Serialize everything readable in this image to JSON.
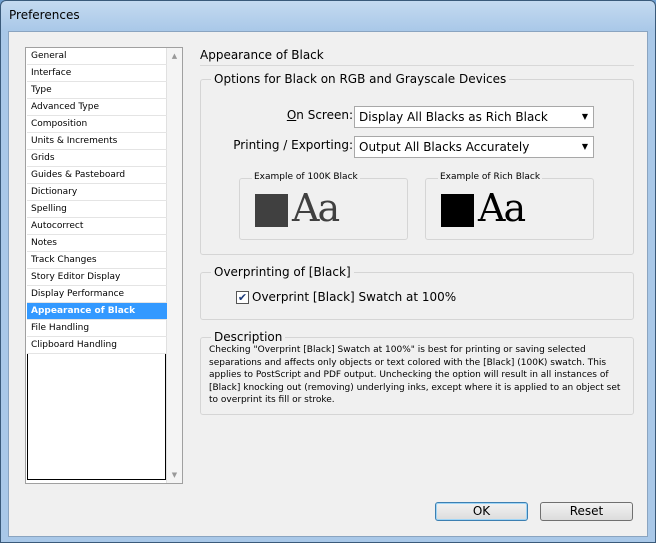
{
  "window": {
    "title": "Preferences"
  },
  "sidebar": {
    "items": [
      "General",
      "Interface",
      "Type",
      "Advanced Type",
      "Composition",
      "Units & Increments",
      "Grids",
      "Guides & Pasteboard",
      "Dictionary",
      "Spelling",
      "Autocorrect",
      "Notes",
      "Track Changes",
      "Story Editor Display",
      "Display Performance",
      "Appearance of Black",
      "File Handling",
      "Clipboard Handling"
    ],
    "selected": "Appearance of Black"
  },
  "main": {
    "heading": "Appearance of Black",
    "options": {
      "title": "Options for Black on RGB and Grayscale Devices",
      "on_screen_label": "On Screen:",
      "on_screen_value": "Display All Blacks as Rich Black",
      "printing_label": "Printing / Exporting:",
      "printing_value": "Output All Blacks Accurately",
      "example_100k": "Example of 100K Black",
      "example_rich": "Example of Rich Black",
      "sample_text": "Aa",
      "color_100k": "#404040",
      "color_rich": "#000000"
    },
    "overprint": {
      "title": "Overprinting of [Black]",
      "checkbox_label": "Overprint [Black] Swatch at 100%",
      "checked": true
    },
    "description": {
      "title": "Description",
      "text": "Checking \"Overprint [Black] Swatch at 100%\" is best for printing or saving selected separations and affects only objects or text colored with the [Black] (100K) swatch. This applies to PostScript and PDF output. Unchecking the option will result in all instances of [Black] knocking out (removing) underlying inks, except where it is applied to an object set to overprint its fill or stroke."
    }
  },
  "buttons": {
    "ok": "OK",
    "reset": "Reset"
  },
  "accent": "#3399ff"
}
